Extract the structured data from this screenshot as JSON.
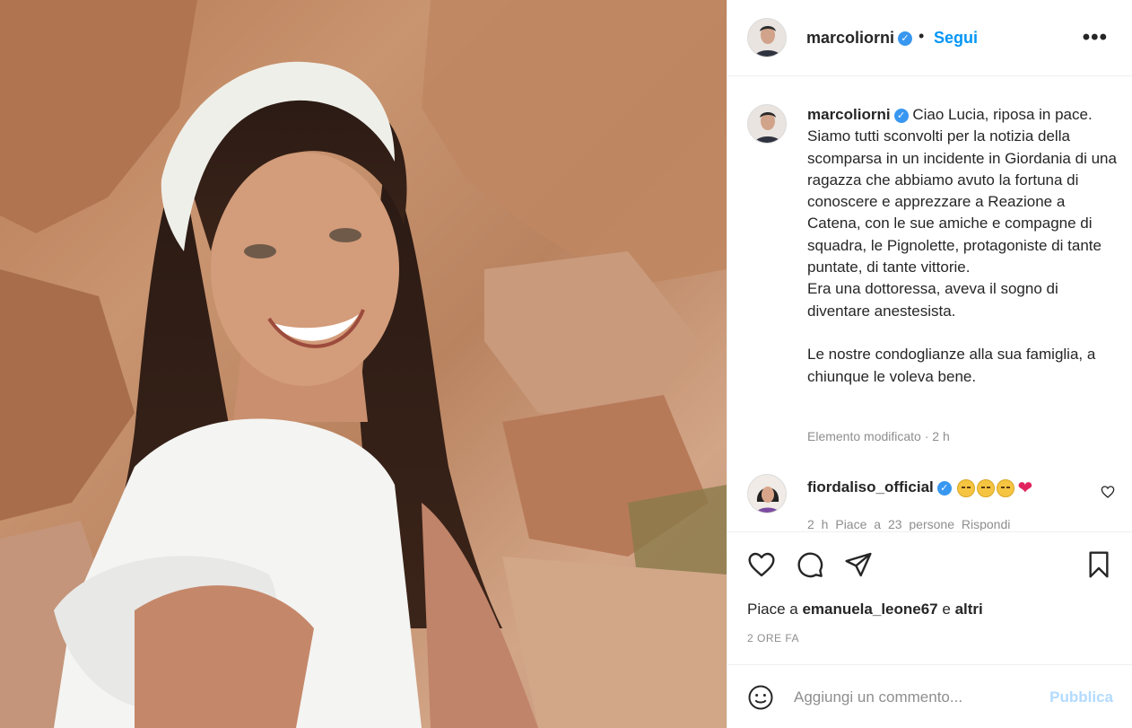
{
  "post": {
    "author": "marcoliorni",
    "follow_label": "Segui",
    "more_label": "•••",
    "bullet": "•",
    "verified_mark": "✓"
  },
  "caption": {
    "username": "marcoliorni",
    "text": "Ciao Lucia, riposa in pace.\nSiamo tutti sconvolti per la notizia della scomparsa in un incidente in Giordania di una ragazza che abbiamo avuto la fortuna di conoscere e apprezzare a Reazione a Catena, con le sue amiche e compagne di squadra, le Pignolette, protagoniste di tante puntate, di tante vittorie.\nEra una dottoressa, aveva il sogno di diventare anestesista.\n\nLe nostre condoglianze alla sua famiglia, a chiunque le voleva bene.",
    "edited_label": "Elemento modificato · 2 h"
  },
  "comment": {
    "username": "fiordaliso_official",
    "emojis": [
      "disappointed-face",
      "disappointed-face",
      "disappointed-face"
    ],
    "heart": "❤",
    "meta": "2 h  Piace a 23 persone  Rispondi"
  },
  "likes": {
    "prefix": "Piace a",
    "user": "emanuela_leone67",
    "suffix": "e altri"
  },
  "time_ago": "2 ORE FA",
  "add_comment": {
    "placeholder": "Aggiungi un commento...",
    "publish_label": "Pubblica"
  },
  "icons": {
    "like": "heart-outline-icon",
    "comment": "comment-bubble-icon",
    "share": "paper-plane-icon",
    "save": "bookmark-icon",
    "emoji": "smiley-icon"
  },
  "colors": {
    "link_blue": "#0095f6",
    "verified_blue": "#3897f0",
    "publish_disabled": "#b3dbff",
    "muted": "#8e8e8e"
  }
}
